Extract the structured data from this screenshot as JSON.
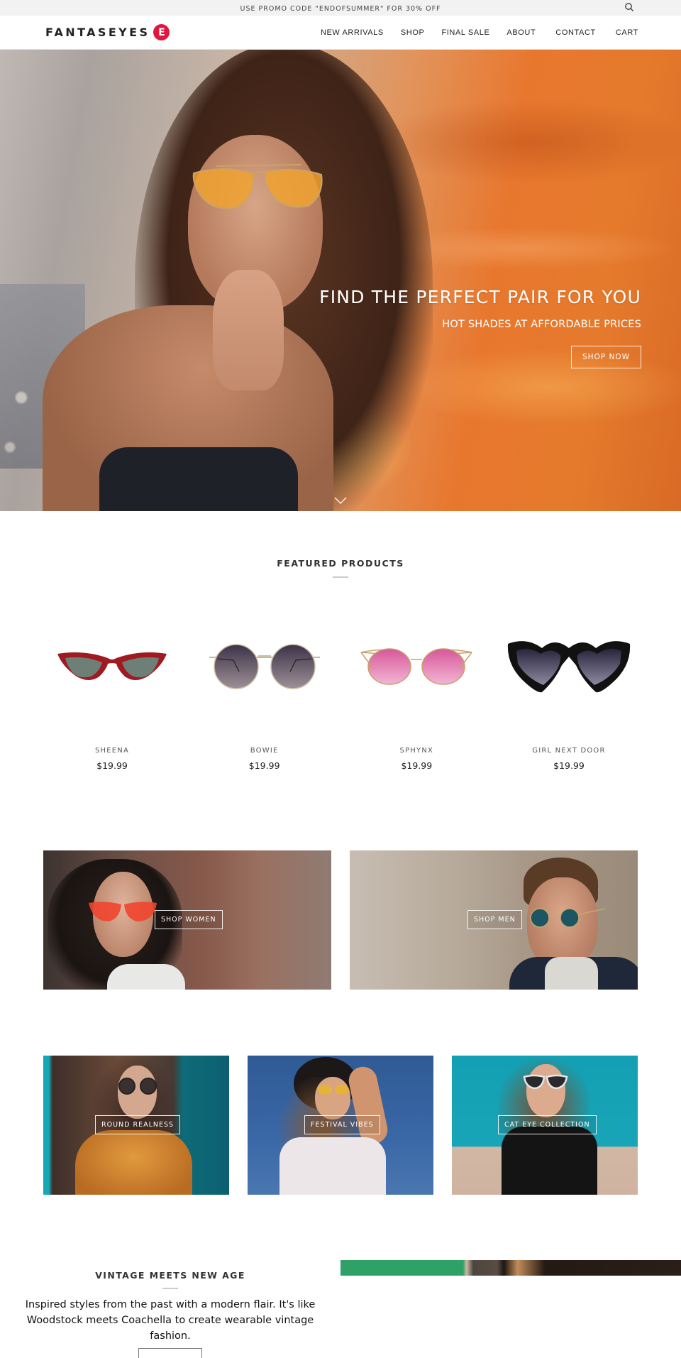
{
  "promo": {
    "text": "USE PROMO CODE \"ENDOFSUMMER\" FOR 30% OFF",
    "icon": "search-icon"
  },
  "header": {
    "logo_text": "FANTASEYES",
    "logo_badge": "E",
    "brand_color": "#e3143e",
    "nav": [
      {
        "label": "NEW ARRIVALS"
      },
      {
        "label": "SHOP"
      },
      {
        "label": "FINAL SALE"
      },
      {
        "label": "ABOUT"
      },
      {
        "label": "CONTACT"
      },
      {
        "label": "CART"
      }
    ]
  },
  "hero": {
    "title": "FIND THE PERFECT PAIR FOR YOU",
    "subtitle": "HOT SHADES AT AFFORDABLE PRICES",
    "button": "SHOP NOW",
    "scroll_icon": "chevron-down-icon"
  },
  "featured": {
    "title": "FEATURED PRODUCTS",
    "products": [
      {
        "name": "SHEENA",
        "price": "$19.99"
      },
      {
        "name": "BOWIE",
        "price": "$19.99"
      },
      {
        "name": "SPHYNX",
        "price": "$19.99"
      },
      {
        "name": "GIRL NEXT DOOR",
        "price": "$19.99"
      }
    ]
  },
  "collections_primary": [
    {
      "label": "SHOP WOMEN"
    },
    {
      "label": "SHOP MEN"
    }
  ],
  "collections_secondary": [
    {
      "label": "ROUND REALNESS"
    },
    {
      "label": "FESTIVAL VIBES"
    },
    {
      "label": "CAT EYE COLLECTION"
    }
  ],
  "vintage": {
    "title": "VINTAGE MEETS NEW AGE",
    "body": "Inspired styles from the past with a modern flair. It's like Woodstock meets Coachella to create wearable vintage fashion."
  }
}
